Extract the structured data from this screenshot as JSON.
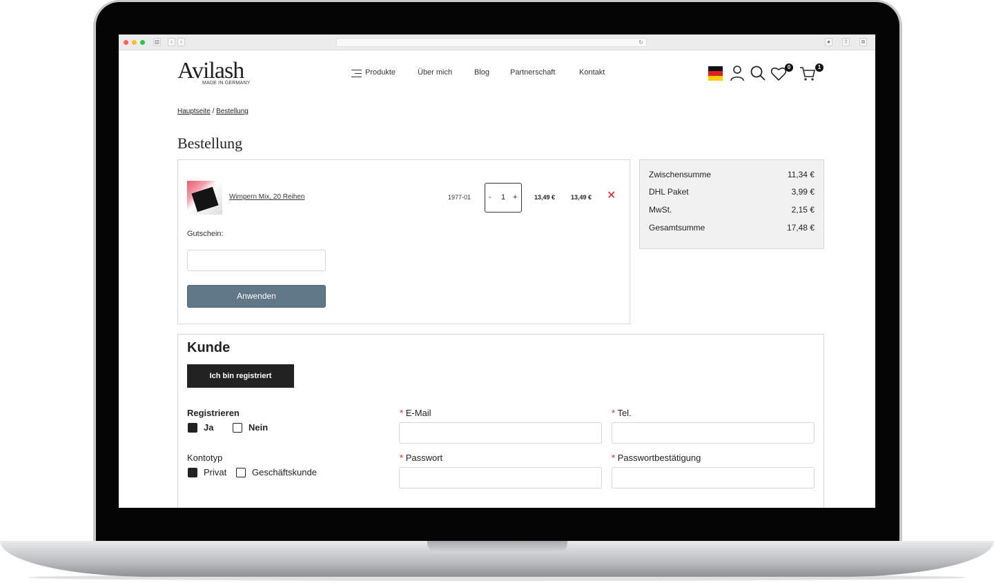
{
  "header": {
    "logo": "Avilash",
    "logo_sub": "MADE IN GERMANY",
    "nav": [
      "Produkte",
      "Über mich",
      "Blog",
      "Partnerschaft",
      "Kontakt"
    ],
    "wishlist_count": "0",
    "cart_count": "1"
  },
  "breadcrumb": {
    "home": "Hauptseite",
    "sep": "/",
    "current": "Bestellung"
  },
  "page_title": "Bestellung",
  "cart": {
    "item": {
      "name": "Wimpern Mix, 20 Reihen",
      "sku": "1977-01",
      "qty_minus": "-",
      "qty": "1",
      "qty_plus": "+",
      "unit_price": "13,49 €",
      "total_price": "13,49 €",
      "remove": "✕"
    },
    "coupon_label": "Gutschein:",
    "coupon_value": "",
    "apply_label": "Anwenden"
  },
  "summary": [
    {
      "label": "Zwischensumme",
      "value": "11,34 €"
    },
    {
      "label": "DHL Paket",
      "value": "3,99 €"
    },
    {
      "label": "MwSt.",
      "value": "2,15 €"
    },
    {
      "label": "Gesamtsumme",
      "value": "17,48 €"
    }
  ],
  "customer": {
    "title": "Kunde",
    "registered_btn": "Ich bin registriert",
    "register_label": "Registrieren",
    "register_yes": "Ja",
    "register_no": "Nein",
    "account_type_label": "Kontotyp",
    "account_private": "Privat",
    "account_business": "Geschäftskunde",
    "email_label": "E-Mail",
    "phone_label": "Tel.",
    "password_label": "Passwort",
    "password_confirm_label": "Passwortbestätigung",
    "required_mark": "*"
  },
  "colors": {
    "accent_button": "#5f7786",
    "dark_button": "#222222",
    "remove": "#e01e1e",
    "summary_bg": "#f1f1f1"
  },
  "icons": [
    "menu-icon",
    "flag-de-icon",
    "user-icon",
    "search-icon",
    "heart-icon",
    "cart-icon",
    "close-icon",
    "reload-icon"
  ]
}
